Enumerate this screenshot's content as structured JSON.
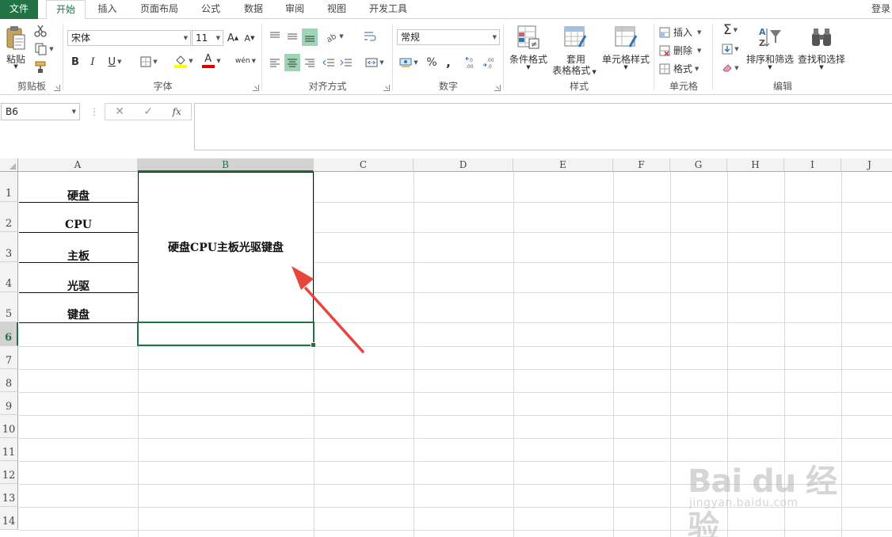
{
  "tabs": {
    "file": "文件",
    "items": [
      "开始",
      "插入",
      "页面布局",
      "公式",
      "数据",
      "审阅",
      "视图",
      "开发工具"
    ],
    "login": "登录"
  },
  "ribbon": {
    "clipboard": {
      "label": "剪贴板",
      "paste": "粘贴"
    },
    "font": {
      "label": "字体",
      "name": "宋体",
      "size": "11",
      "bold": "B",
      "italic": "I",
      "underline": "U",
      "grow": "A",
      "shrink": "A",
      "color_letter": "A",
      "phonetic": "wén"
    },
    "alignment": {
      "label": "对齐方式"
    },
    "number": {
      "label": "数字",
      "format": "常规",
      "percent": "%",
      "comma": ","
    },
    "styles": {
      "label": "样式",
      "conditional": "条件格式",
      "table_line1": "套用",
      "table_line2": "表格格式",
      "cell_styles": "单元格样式"
    },
    "cells": {
      "label": "单元格",
      "insert": "插入",
      "delete": "删除",
      "format": "格式"
    },
    "editing": {
      "label": "编辑",
      "sum": "Σ",
      "sort": "排序和筛选",
      "find": "查找和选择"
    }
  },
  "formula_bar": {
    "namebox": "B6",
    "cancel": "✕",
    "enter": "✓",
    "fx": "fx",
    "value": ""
  },
  "columns": [
    "A",
    "B",
    "C",
    "D",
    "E",
    "F",
    "G",
    "H",
    "I",
    "J"
  ],
  "rows": [
    "1",
    "2",
    "3",
    "4",
    "5",
    "6",
    "7",
    "8",
    "9",
    "10",
    "11",
    "12",
    "13",
    "14"
  ],
  "cells": {
    "A1": "硬盘",
    "A2": "CPU",
    "A3": "主板",
    "A4": "光驱",
    "A5": "键盘",
    "B1_merged": "硬盘CPU主板光驱键盘"
  },
  "watermark": {
    "main": "Bai du 经验",
    "sub": "jingyan.baidu.com"
  },
  "colors": {
    "accent": "#217346",
    "arrow": "#e8453c"
  }
}
